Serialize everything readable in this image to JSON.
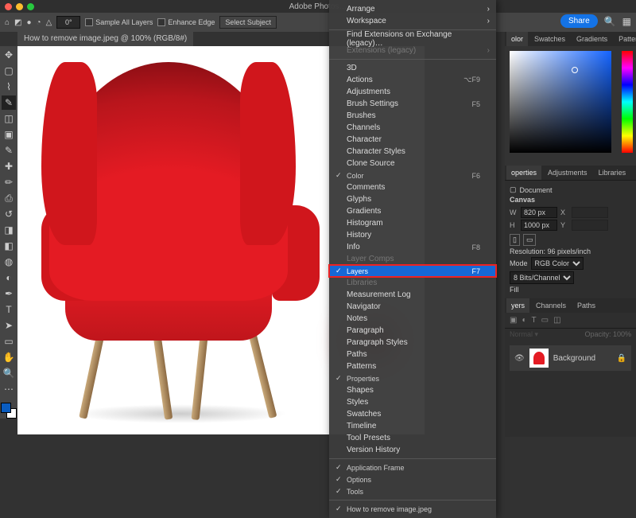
{
  "titlebar": {
    "title": "Adobe Photos…"
  },
  "options": {
    "angle": "0°",
    "sample_all": "Sample All Layers",
    "enhance_edge": "Enhance Edge",
    "select_subject": "Select Subject"
  },
  "topright": {
    "share": "Share"
  },
  "document": {
    "tab": "How to remove image.jpeg @ 100% (RGB/8#)"
  },
  "menu": {
    "items": [
      {
        "label": "Arrange",
        "sub": true
      },
      {
        "label": "Workspace",
        "sub": true
      },
      {
        "sep": true
      },
      {
        "label": "Find Extensions on Exchange (legacy)…"
      },
      {
        "label": "Extensions (legacy)",
        "sub": true,
        "dis": true
      },
      {
        "sep": true
      },
      {
        "label": "3D"
      },
      {
        "label": "Actions",
        "shortcut": "⌥F9"
      },
      {
        "label": "Adjustments"
      },
      {
        "label": "Brush Settings",
        "shortcut": "F5"
      },
      {
        "label": "Brushes"
      },
      {
        "label": "Channels"
      },
      {
        "label": "Character"
      },
      {
        "label": "Character Styles"
      },
      {
        "label": "Clone Source"
      },
      {
        "label": "Color",
        "chk": true,
        "shortcut": "F6"
      },
      {
        "label": "Comments"
      },
      {
        "label": "Glyphs"
      },
      {
        "label": "Gradients"
      },
      {
        "label": "Histogram"
      },
      {
        "label": "History"
      },
      {
        "label": "Info",
        "shortcut": "F8"
      },
      {
        "label": "Layer Comps",
        "dis": true
      },
      {
        "label": "Layers",
        "chk": true,
        "shortcut": "F7",
        "highlight": true
      },
      {
        "label": "Libraries",
        "dis": true
      },
      {
        "label": "Measurement Log"
      },
      {
        "label": "Navigator"
      },
      {
        "label": "Notes"
      },
      {
        "label": "Paragraph"
      },
      {
        "label": "Paragraph Styles"
      },
      {
        "label": "Paths"
      },
      {
        "label": "Patterns"
      },
      {
        "label": "Properties",
        "chk": true
      },
      {
        "label": "Shapes"
      },
      {
        "label": "Styles"
      },
      {
        "label": "Swatches"
      },
      {
        "label": "Timeline"
      },
      {
        "label": "Tool Presets"
      },
      {
        "label": "Version History"
      },
      {
        "sep": true
      },
      {
        "label": "Application Frame",
        "chk": true
      },
      {
        "label": "Options",
        "chk": true
      },
      {
        "label": "Tools",
        "chk": true
      },
      {
        "sep": true
      },
      {
        "label": "How to remove image.jpeg",
        "chk": true
      }
    ]
  },
  "right": {
    "color_tabs": [
      "olor",
      "Swatches",
      "Gradients",
      "Patterns"
    ],
    "prop_tabs": [
      "operties",
      "Adjustments",
      "Libraries"
    ],
    "prop_kind": "Document",
    "canvas": {
      "heading": "Canvas",
      "w_label": "W",
      "w": "820 px",
      "x_label": "X",
      "h_label": "H",
      "h": "1000 px",
      "y_label": "Y",
      "resolution": "Resolution: 96 pixels/inch",
      "mode_label": "Mode",
      "mode": "RGB Color",
      "depth": "8 Bits/Channel",
      "fill_label": "Fill"
    },
    "layer_tabs": [
      "yers",
      "Channels",
      "Paths"
    ],
    "opacity_label": "Opacity:",
    "opacity_val": "100%",
    "layer_name": "Background"
  }
}
